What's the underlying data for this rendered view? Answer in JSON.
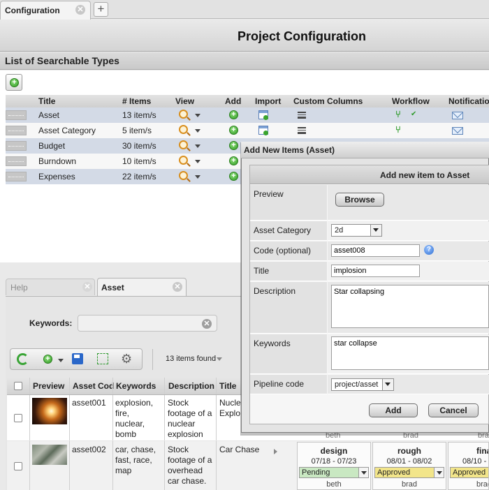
{
  "tabs": {
    "config_label": "Configuration",
    "close_symbol": "✕",
    "add_symbol": "+"
  },
  "header": {
    "title": "Project Configuration"
  },
  "section": {
    "title": "List of Searchable Types"
  },
  "types_table": {
    "columns": [
      "Title",
      "# Items",
      "View",
      "Add",
      "Import",
      "Custom Columns",
      "Workflow",
      "Notification"
    ],
    "rows": [
      {
        "title": "Asset",
        "items": "13 item/s"
      },
      {
        "title": "Asset Category",
        "items": "5 item/s"
      },
      {
        "title": "Budget",
        "items": "30 item/s"
      },
      {
        "title": "Burndown",
        "items": "10 item/s"
      },
      {
        "title": "Expenses",
        "items": "22 item/s"
      }
    ]
  },
  "lower_tabs": {
    "help": "Help",
    "asset": "Asset"
  },
  "search": {
    "keywords_label": "Keywords:",
    "keywords_value": "",
    "found": "13 items found"
  },
  "results": {
    "columns": [
      "Preview",
      "Asset Cod",
      "Keywords",
      "Description",
      "Title"
    ],
    "rows": [
      {
        "code": "asset001",
        "keywords": [
          "explosion,",
          "fire,",
          "nuclear,",
          "bomb"
        ],
        "description": [
          "Stock",
          "footage of a",
          "nuclear",
          "explosion"
        ],
        "title": [
          "Nucle",
          "Explo"
        ]
      },
      {
        "code": "asset002",
        "keywords": [
          "car, chase,",
          "fast, race,",
          "map"
        ],
        "description": [
          "Stock",
          "footage of a",
          "overhead",
          "car chase."
        ],
        "title": [
          "Car Chase"
        ]
      }
    ],
    "row1_partial": [
      "beth",
      "brad",
      "brad"
    ]
  },
  "workflow_cards": [
    {
      "name": "design",
      "dates": "07/18 - 07/23",
      "status": "Pending",
      "status_color": "#c9e8c2",
      "user": "beth"
    },
    {
      "name": "rough",
      "dates": "08/01 - 08/02",
      "status": "Approved",
      "status_color": "#f2e58a",
      "user": "brad"
    },
    {
      "name": "fina",
      "dates": "08/10 -",
      "status": "Approved",
      "status_color": "#f2e58a",
      "user": "brad"
    }
  ],
  "dialog": {
    "title": "Add New Items (Asset)",
    "heading": "Add new item to Asset",
    "preview_label": "Preview",
    "browse_label": "Browse",
    "category_label": "Asset Category",
    "category_value": "2d",
    "code_label": "Code (optional)",
    "code_value": "asset008",
    "help_symbol": "?",
    "title_label": "Title",
    "title_value": "implosion",
    "description_label": "Description",
    "description_value": "Star collapsing",
    "keywords_label": "Keywords",
    "keywords_value": "star collapse",
    "pipeline_label": "Pipeline code",
    "pipeline_value": "project/asset",
    "add_label": "Add",
    "cancel_label": "Cancel"
  },
  "icons": {
    "plus": "+",
    "gear": "⚙",
    "fit": "⤢",
    "workflow": "⑂",
    "check": "✔"
  }
}
